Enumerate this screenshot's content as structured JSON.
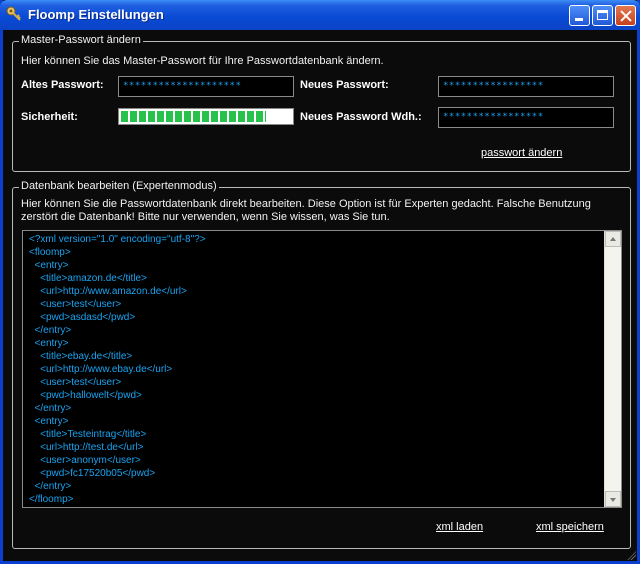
{
  "window": {
    "title": "Floomp Einstellungen",
    "icon": "key-icon"
  },
  "master": {
    "legend": "Master-Passwort ändern",
    "description": "Hier können Sie das Master-Passwort für Ihre Passwortdatenbank ändern.",
    "old_label": "Altes Passwort:",
    "old_value": "********************",
    "new_label": "Neues Passwort:",
    "new_value": "*****************",
    "strength_label": "Sicherheit:",
    "strength_level": 0.85,
    "repeat_label": "Neues Password Wdh.:",
    "repeat_value": "*****************",
    "change_link": "passwort ändern"
  },
  "database": {
    "legend": "Datenbank bearbeiten (Expertenmodus)",
    "description": "Hier können Sie die Passwortdatenbank direkt bearbeiten. Diese Option ist für Experten gedacht. Falsche Benutzung\nzerstört die Datenbank! Bitte nur verwenden, wenn Sie wissen, was Sie tun.",
    "xml": "<?xml version=\"1.0\" encoding=\"utf-8\"?>\n<floomp>\n  <entry>\n    <title>amazon.de</title>\n    <url>http://www.amazon.de</url>\n    <user>test</user>\n    <pwd>asdasd</pwd>\n  </entry>\n  <entry>\n    <title>ebay.de</title>\n    <url>http://www.ebay.de</url>\n    <user>test</user>\n    <pwd>hallowelt</pwd>\n  </entry>\n  <entry>\n    <title>Testeintrag</title>\n    <url>http://test.de</url>\n    <user>anonym</user>\n    <pwd>fc17520b05</pwd>\n  </entry>\n</floomp>",
    "load_link": "xml laden",
    "save_link": "xml speichern"
  },
  "colors": {
    "titlebar": "#0a4bd6",
    "field_text": "#1aa3f0",
    "strength": "#27c24c"
  }
}
